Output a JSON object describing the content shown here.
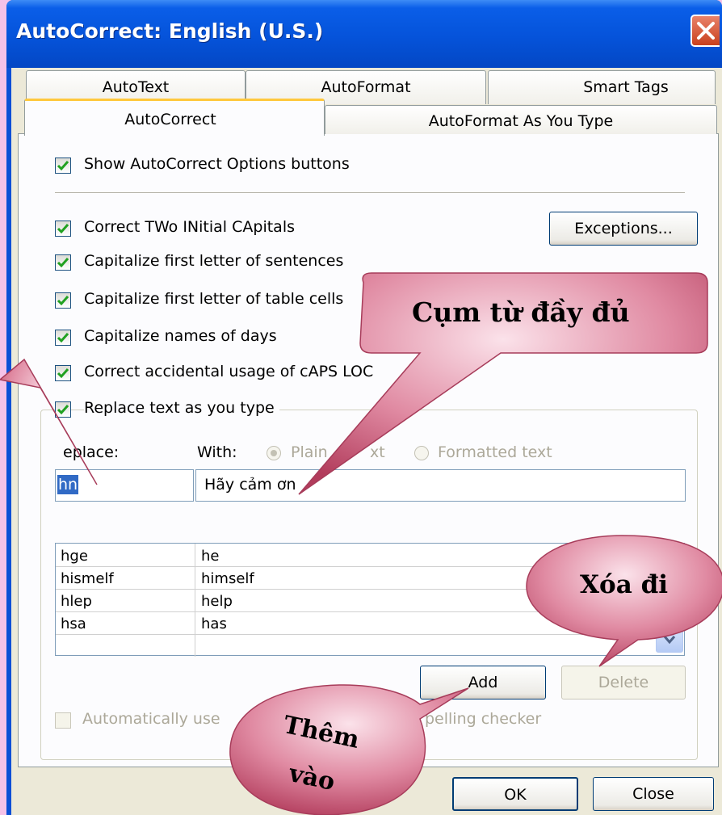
{
  "window": {
    "title": "AutoCorrect: English (U.S.)"
  },
  "tabs": {
    "row1": [
      "AutoText",
      "AutoFormat",
      "Smart Tags"
    ],
    "row2": [
      "AutoCorrect",
      "AutoFormat As You Type"
    ],
    "active": "AutoCorrect"
  },
  "options": {
    "show_buttons": {
      "label": "Show AutoCorrect Options buttons",
      "checked": true
    },
    "two_initial": {
      "label": "Correct TWo INitial CApitals",
      "checked": true
    },
    "first_letter_sentences": {
      "label": "Capitalize first letter of sentences",
      "checked": true
    },
    "first_letter_cells": {
      "label": "Capitalize first letter of table cells",
      "checked": true
    },
    "names_of_days": {
      "label": "Capitalize names of days",
      "checked": true
    },
    "caps_lock": {
      "label": "Correct accidental usage of cAPS LOC",
      "checked": true
    },
    "replace_text": {
      "label": "Replace text as you type",
      "checked": true
    },
    "auto_suggest": {
      "label": "Automatically use",
      "label_tail": "pelling checker",
      "checked": false
    }
  },
  "buttons": {
    "exceptions": "Exceptions...",
    "add": "Add",
    "delete": "Delete",
    "ok": "OK",
    "close": "Close"
  },
  "replace_section": {
    "replace_label": "eplace:",
    "with_label": "With:",
    "plain_text_label": "Plain",
    "plain_text_tail": "xt",
    "formatted_text_label": "Formatted text",
    "replace_value": "hn",
    "with_value": "Hãy cảm ơn"
  },
  "entries": [
    {
      "replace": "hge",
      "with": "he"
    },
    {
      "replace": "hismelf",
      "with": "himself"
    },
    {
      "replace": "hlep",
      "with": "help"
    },
    {
      "replace": "hsa",
      "with": "has"
    }
  ],
  "callouts": {
    "full_phrase": "Cụm từ đầy đủ",
    "delete_hint": "Xóa đi",
    "add_hint_line1": "Thêm",
    "add_hint_line2": "vào"
  },
  "colors": {
    "title_bar": "#0553da",
    "dialog_face": "#ece9d8",
    "callout_fill": "#c8506e",
    "background": "#f4c2e8"
  }
}
